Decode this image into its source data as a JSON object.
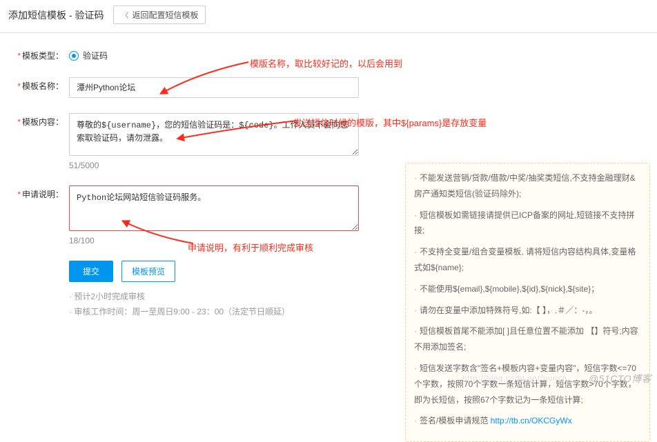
{
  "header": {
    "title": "添加短信模板 - 验证码",
    "back_label": "返回配置短信模板"
  },
  "form": {
    "type": {
      "label": "模板类型：",
      "option": "验证码"
    },
    "name": {
      "label": "模板名称：",
      "value": "潭州Python论坛"
    },
    "content": {
      "label": "模板内容：",
      "value": "尊敬的${username}，您的短信验证码是：${code}。工作人员不会向您索取验证码，请勿泄露。",
      "counter": "51/5000"
    },
    "reason": {
      "label": "申请说明：",
      "value": "Python论坛网站短信验证码服务。",
      "counter": "18/100"
    },
    "submit": "提交",
    "preview": "模板预览",
    "eta": "预计2小时完成审核",
    "hours": "审核工作时间：周一至周日9:00 - 23：00（法定节日顺延）"
  },
  "tips": {
    "i1": "不能发送营销/贷款/借款/中奖/抽奖类短信,不支持金融理财&房产通知类短信(验证码除外);",
    "i2": "短信模板如需链接请提供已ICP备案的网址,短链接不支持拼接;",
    "i3": "不支持全变量/组合变量模板, 请将短信内容结构具体,变量格式如${name};",
    "i4": "不能使用${email},${mobile},${id},${nick},${site}；",
    "i5": "请勿在变量中添加特殊符号,如:【 】，.＃／：-，。",
    "i6": "短信模板首尾不能添加[ ]且任意位置不能添加 【】符号;内容不用添加签名;",
    "i7": "短信发送字数含\"签名+模板内容+变量内容\"，短信字数<=70个字数，按照70个字数一条短信计算，短信字数>70个字数，即为长短信，按照67个字数记为一条短信计算;",
    "i8a": "签名/模板申请规范 ",
    "i8link": "http://tb.cn/OKCGyWx"
  },
  "annotations": {
    "a1": "模版名称，取比较好记的，以后会用到",
    "a2": "发送短信时候的模版，其中${params}是存放变量",
    "a3": "申请说明，有利于顺利完成审核"
  },
  "watermark": "@51CTO博客",
  "watermark2": "http://blog.csdn.net/nunch"
}
